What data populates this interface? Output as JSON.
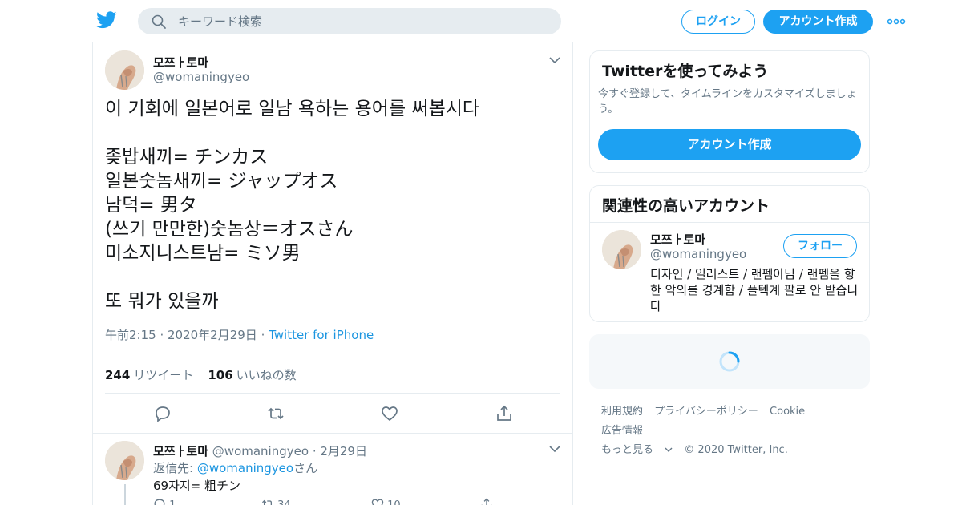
{
  "header": {
    "search_placeholder": "キーワード検索",
    "login_label": "ログイン",
    "signup_label": "アカウント作成",
    "icons": [
      "twitter-bird-icon",
      "search-icon",
      "more-dots-icon"
    ],
    "brand_color": "#1da1f2"
  },
  "tweet": {
    "author_name": "모쯔ㅏ토마",
    "author_handle": "@womaningyeo",
    "text": "이 기회에 일본어로 일남 욕하는 용어를 써봅시다\n\n좆밥새끼= チンカス\n일본숫놈새끼= ジャップオス\n남덕= 男タ\n(쓰기 만만한)숫놈상＝オスさん\n미소지니스트남= ミソ男\n\n또 뭐가 있을까",
    "timestamp": "午前2:15 · 2020年2月29日",
    "meta_separator": " · ",
    "source": "Twitter for iPhone",
    "retweet_count": "244",
    "retweet_label": "リツイート",
    "like_count": "106",
    "like_label": "いいねの数"
  },
  "reply": {
    "author_name": "모쯔ㅏ토마",
    "author_handle": "@womaningyeo",
    "date": "· 2月29日",
    "reply_prefix": "返信先:",
    "reply_to": "@womaningyeo",
    "reply_suffix": "さん",
    "text": "69자지= 粗チン",
    "reply_count": "1",
    "retweet_count": "34",
    "like_count": "10"
  },
  "sidebar": {
    "signup_title": "Twitterを使ってみよう",
    "signup_desc": "今すぐ登録して、タイムラインをカスタマイズしましょう。",
    "signup_button": "アカウント作成",
    "related_title": "関連性の高いアカウント",
    "related_name": "모쯔ㅏ토마",
    "related_handle": "@womaningyeo",
    "follow_label": "フォロー",
    "related_bio": "디자인 / 일러스트 / 랜펨아님 / 랜펨을 향한 악의를 경계함 / 플텍계 팔로 안 받습니다"
  },
  "footer": {
    "links": [
      "利用規約",
      "プライバシーポリシー",
      "Cookie",
      "広告情報"
    ],
    "more_label": "もっと見る",
    "copyright": "© 2020 Twitter, Inc."
  }
}
